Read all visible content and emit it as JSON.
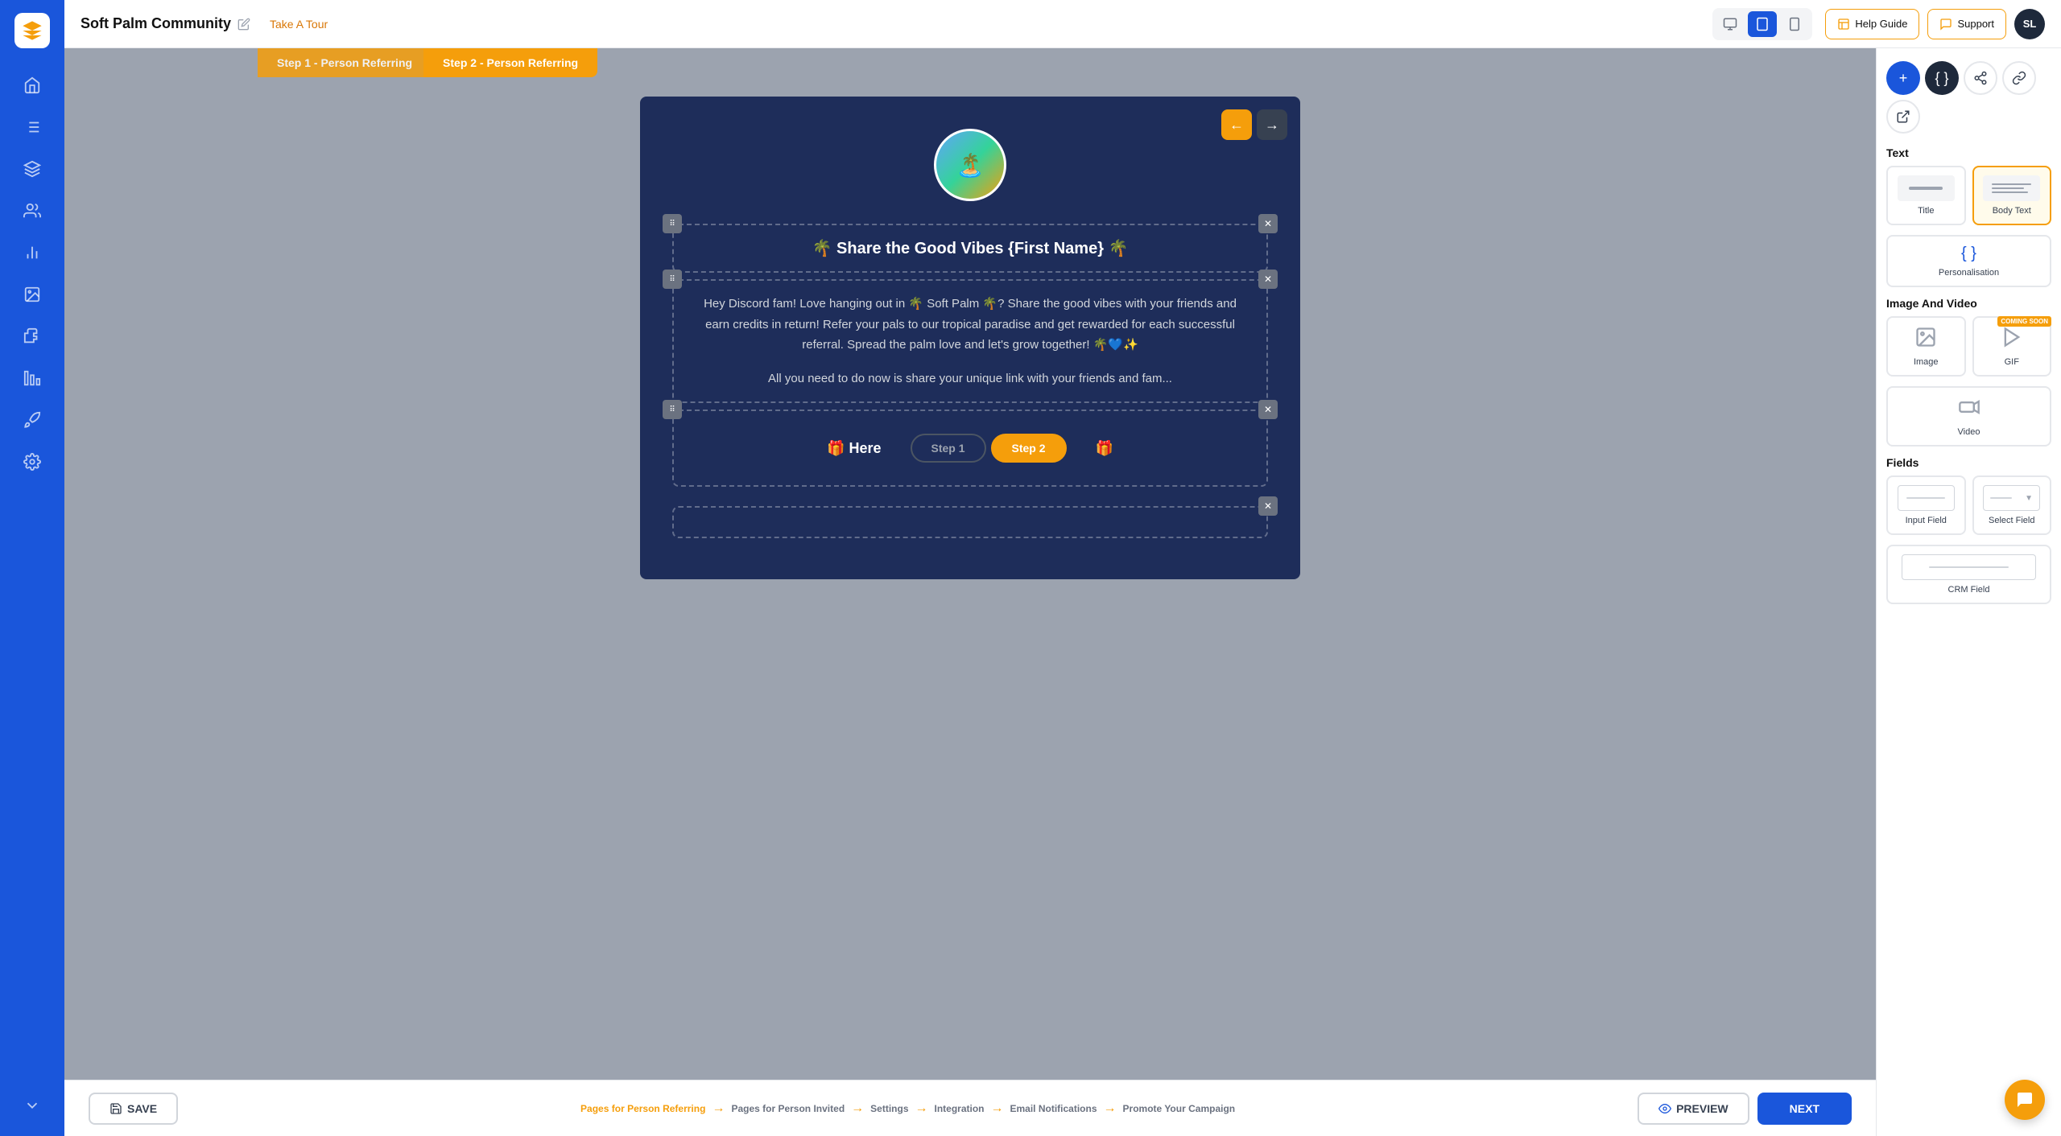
{
  "app": {
    "title": "Soft Palm Community",
    "tour_label": "Take A Tour",
    "avatar": "SL"
  },
  "topbar": {
    "help_label": "Help Guide",
    "support_label": "Support"
  },
  "steps": {
    "step1_label": "Step 1 - Person Referring",
    "step2_label": "Step 2 - Person Referring"
  },
  "canvas": {
    "logo_emoji": "🏝️",
    "title_block": "🌴 Share the Good Vibes {First Name} 🌴",
    "body_block_1": "Hey Discord fam! Love hanging out in 🌴 Soft Palm 🌴? Share the good vibes with your friends and earn credits in return! Refer your pals to our tropical paradise and get rewarded for each successful referral. Spread the palm love and let's grow together! 🌴💙✨",
    "body_block_2": "All you need to do now is share your unique link with your friends and fam...",
    "hero_text": "🎁 Here",
    "step_ind_1": "Step 1",
    "step_ind_2": "Step 2"
  },
  "buttons": {
    "save": "SAVE",
    "preview": "PREVIEW",
    "next": "NEXT"
  },
  "breadcrumb": {
    "items": [
      "Pages for Person Referring",
      "Pages for Person Invited",
      "Settings",
      "Integration",
      "Email Notifications",
      "Promote Your Campaign"
    ]
  },
  "right_panel": {
    "section_text": "Text",
    "item_title": "Title",
    "item_body": "Body Text",
    "item_personalisation": "Personalisation",
    "section_image_video": "Image And Video",
    "item_image": "Image",
    "item_gif": "GIF",
    "item_video": "Video",
    "section_fields": "Fields",
    "item_input": "Input Field",
    "item_select": "Select Field",
    "item_crm": "CRM Field"
  }
}
